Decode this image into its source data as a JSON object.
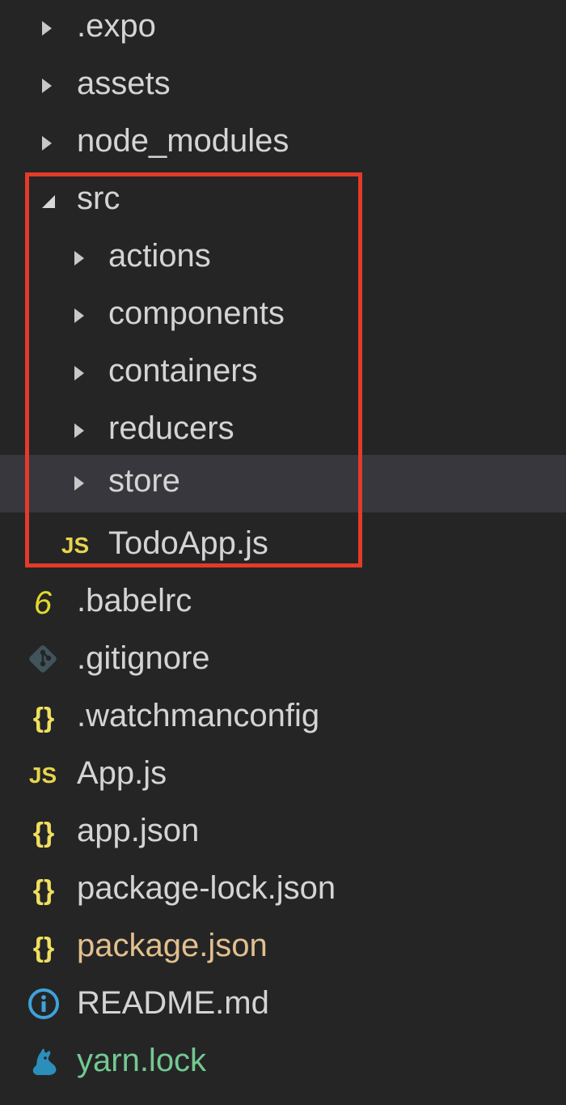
{
  "explorer": {
    "items": [
      {
        "label": ".expo"
      },
      {
        "label": "assets"
      },
      {
        "label": "node_modules"
      },
      {
        "label": "src"
      },
      {
        "label": "actions"
      },
      {
        "label": "components"
      },
      {
        "label": "containers"
      },
      {
        "label": "reducers"
      },
      {
        "label": "store"
      },
      {
        "label": "TodoApp.js",
        "icon_text": "JS"
      },
      {
        "label": ".babelrc",
        "icon_text": "6"
      },
      {
        "label": ".gitignore"
      },
      {
        "label": ".watchmanconfig",
        "icon_text": "{}"
      },
      {
        "label": "App.js",
        "icon_text": "JS"
      },
      {
        "label": "app.json",
        "icon_text": "{}"
      },
      {
        "label": "package-lock.json",
        "icon_text": "{}"
      },
      {
        "label": "package.json",
        "icon_text": "{}"
      },
      {
        "label": "README.md"
      },
      {
        "label": "yarn.lock"
      }
    ]
  },
  "icons": [
    "chevron-right-icon",
    "chevron-down-icon",
    "javascript-icon",
    "babel-icon",
    "git-icon",
    "json-icon",
    "info-icon",
    "yarn-icon"
  ],
  "colors": {
    "background": "#252526",
    "text": "#d4d4d4",
    "selected_row": "#37373d",
    "highlight_border": "#e23b2a",
    "javascript": "#e8d44d",
    "json": "#f0e060",
    "babel": "#e3d92d",
    "git": "#41535b",
    "info": "#3ea3d8",
    "yarn": "#2c8ebb",
    "modified_text": "#e2c08d",
    "added_text": "#73c991"
  }
}
